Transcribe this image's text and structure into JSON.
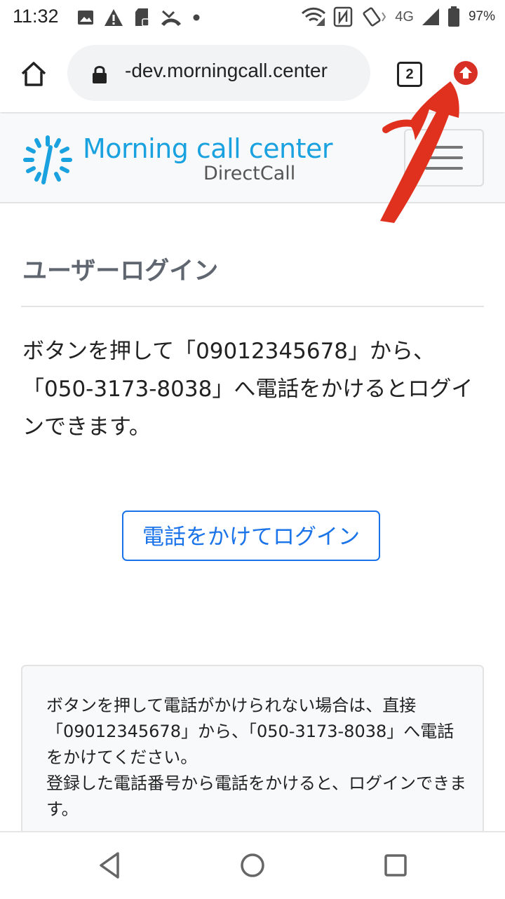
{
  "status_bar": {
    "time": "11:32",
    "network": "4G",
    "battery": "97%",
    "left_icons": [
      "image-icon",
      "warning-icon",
      "sd-card-icon",
      "missed-call-icon",
      "dot-icon"
    ],
    "right_icons": [
      "wifi-icon",
      "nfc-icon",
      "vibrate-icon",
      "signal-icon",
      "battery-icon"
    ]
  },
  "browser": {
    "url": "-dev.morningcall.center",
    "tab_count": "2"
  },
  "site": {
    "logo_title": "Morning call center",
    "logo_subtitle": "DirectCall",
    "brand_color": "#1aa2e0"
  },
  "page": {
    "title": "ユーザーログイン",
    "description": "ボタンを押して「09012345678」から、「050-3173-8038」へ電話をかけるとログインできます。",
    "call_button": "電話をかけてログイン",
    "info_lines": [
      "ボタンを押して電話がかけられない場合は、直接「09012345678」から、「050-3173-8038」へ電話をかけてください。",
      "登録した電話番号から電話をかけると、ログインできます。"
    ]
  },
  "colors": {
    "accent": "#1a73e8",
    "arrow": "#e0301e",
    "update_badge": "#d93025"
  }
}
